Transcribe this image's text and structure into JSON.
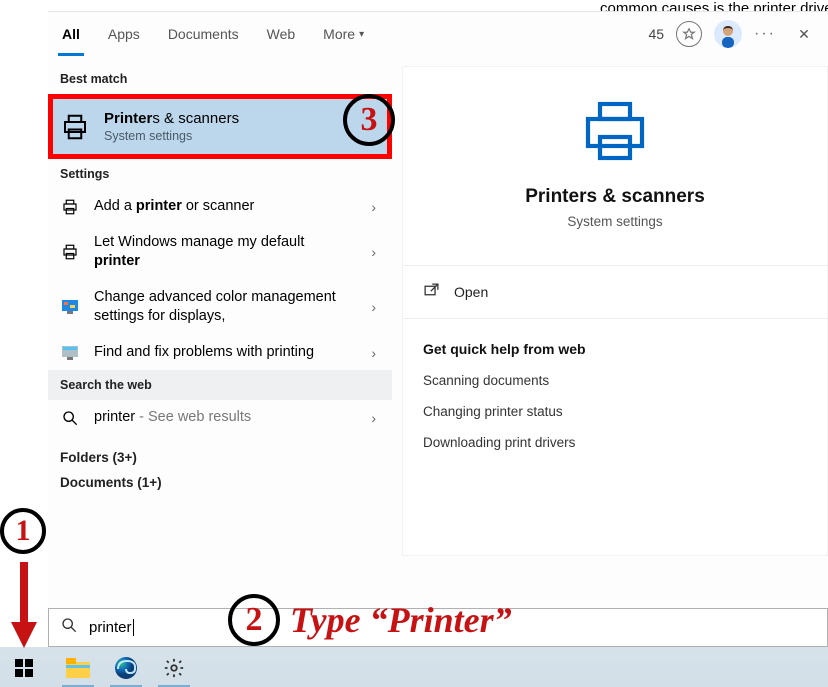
{
  "top_fragment": "common causes is the printer drive",
  "tabs": {
    "all": "All",
    "apps": "Apps",
    "documents": "Documents",
    "web": "Web",
    "more": "More"
  },
  "points": "45",
  "sections": {
    "best_match": "Best match",
    "settings": "Settings",
    "search_web": "Search the web"
  },
  "best_match": {
    "title_prefix": "Printer",
    "title_rest": "s & scanners",
    "sub": "System settings"
  },
  "settings_rows": {
    "r1_a": "Add a ",
    "r1_b": "printer",
    "r1_c": " or scanner",
    "r2_a": "Let Windows manage my default ",
    "r2_b": "printer",
    "r3": "Change advanced color management settings for displays,",
    "r4": "Find and fix problems with printing"
  },
  "web": {
    "term": "printer",
    "suffix": " - See web results"
  },
  "folders": "Folders (3+)",
  "documents": "Documents (1+)",
  "preview": {
    "title": "Printers & scanners",
    "sub": "System settings",
    "open": "Open",
    "help_head": "Get quick help from web",
    "h1": "Scanning documents",
    "h2": "Changing printer status",
    "h3": "Downloading print drivers"
  },
  "search_value": "printer",
  "anno": {
    "n1": "1",
    "n2": "2",
    "n3": "3",
    "type_label": "Type “Printer”"
  }
}
